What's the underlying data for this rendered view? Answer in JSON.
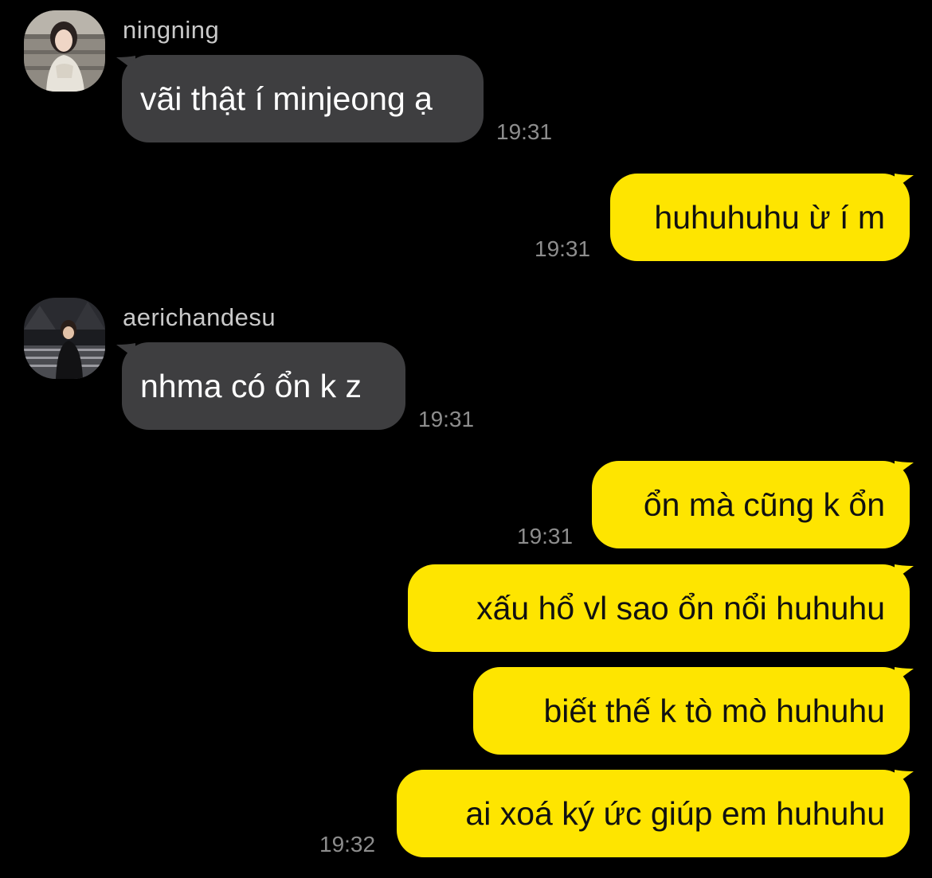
{
  "colors": {
    "background": "#000000",
    "incoming_bubble": "#3e3e40",
    "outgoing_bubble": "#fee500",
    "name_text": "#c9c9c9",
    "time_text": "#8d8d8d"
  },
  "messages": [
    {
      "sender": "ningning",
      "direction": "incoming",
      "text": "vãi thật í minjeong ạ",
      "time": "19:31"
    },
    {
      "direction": "outgoing",
      "text": "huhuhuhu ừ í m",
      "time": "19:31"
    },
    {
      "sender": "aerichandesu",
      "direction": "incoming",
      "text": "nhma có ổn k z",
      "time": "19:31"
    },
    {
      "direction": "outgoing",
      "text": "ổn mà cũng k ổn",
      "time": "19:31"
    },
    {
      "direction": "outgoing",
      "text": "xấu hổ vl sao ổn nổi huhuhu"
    },
    {
      "direction": "outgoing",
      "text": "biết thế k tò mò huhuhu"
    },
    {
      "direction": "outgoing",
      "text": "ai xoá ký ức giúp em huhuhu",
      "time": "19:32"
    }
  ]
}
